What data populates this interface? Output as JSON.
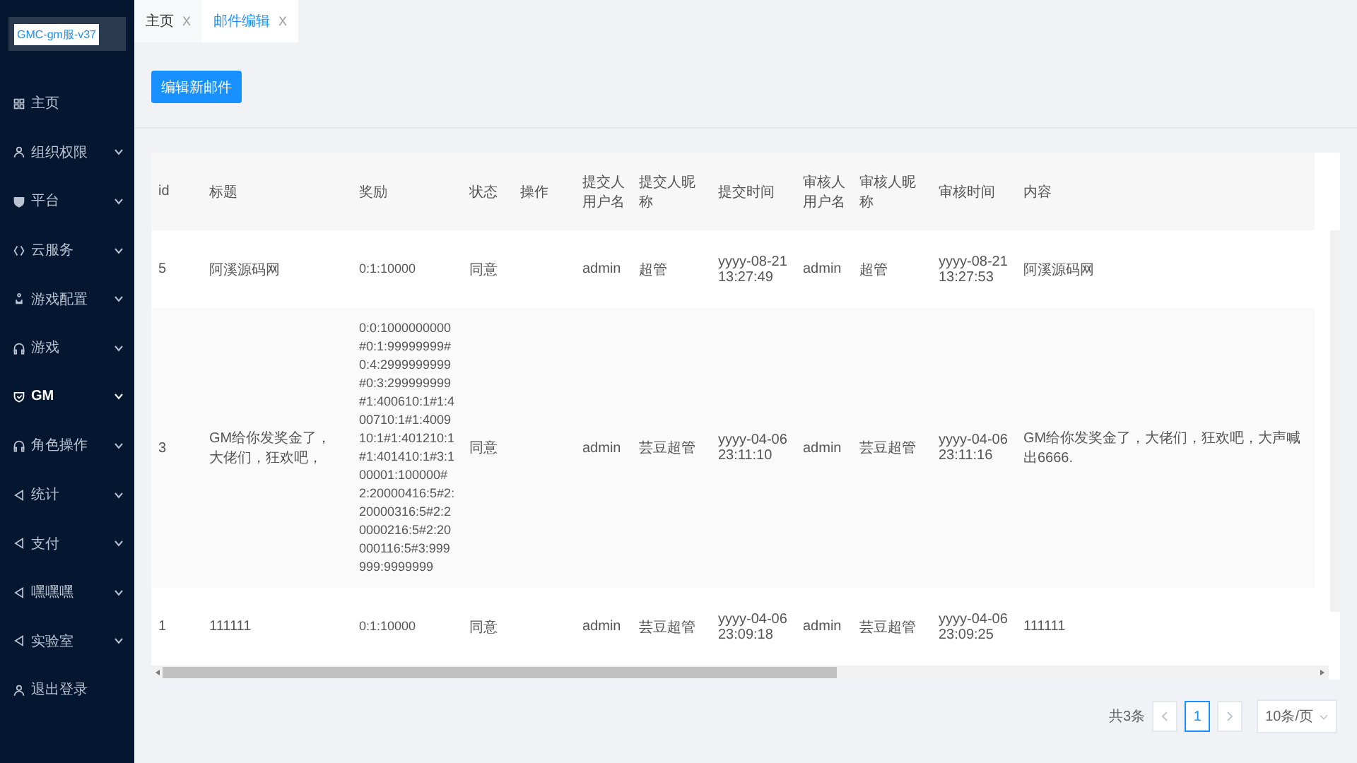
{
  "sidebar": {
    "logo": "GMC-gm服-v37",
    "items": [
      {
        "label": "主页",
        "expandable": false,
        "selected": false
      },
      {
        "label": "组织权限",
        "expandable": true,
        "selected": false
      },
      {
        "label": "平台",
        "expandable": true,
        "selected": false
      },
      {
        "label": "云服务",
        "expandable": true,
        "selected": false
      },
      {
        "label": "游戏配置",
        "expandable": true,
        "selected": false
      },
      {
        "label": "游戏",
        "expandable": true,
        "selected": false
      },
      {
        "label": "GM",
        "expandable": true,
        "selected": true
      },
      {
        "label": "角色操作",
        "expandable": true,
        "selected": false
      },
      {
        "label": "统计",
        "expandable": true,
        "selected": false
      },
      {
        "label": "支付",
        "expandable": true,
        "selected": false
      },
      {
        "label": "嘿嘿嘿",
        "expandable": true,
        "selected": false
      },
      {
        "label": "实验室",
        "expandable": true,
        "selected": false
      },
      {
        "label": "退出登录",
        "expandable": false,
        "selected": false
      }
    ]
  },
  "tabs": [
    {
      "label": "主页",
      "close": "X",
      "selected": false
    },
    {
      "label": "邮件编辑",
      "close": "X",
      "selected": true
    }
  ],
  "new_button": "编辑新邮件",
  "table": {
    "columns": [
      "id",
      "标题",
      "奖励",
      "状态",
      "操作",
      "提交人用户名",
      "提交人昵称",
      "提交时间",
      "审核人用户名",
      "审核人昵称",
      "审核时间",
      "内容"
    ],
    "rows": [
      [
        "5",
        "阿溪源码网",
        "0:1:10000",
        "同意",
        "",
        "admin",
        "超管",
        "yyyy-08-21 13:27:49",
        "admin",
        "超管",
        "yyyy-08-21 13:27:53",
        "阿溪源码网"
      ],
      [
        "3",
        "GM给你发奖金了，大佬们，狂欢吧，",
        "0:0:1000000000#0:1:99999999#0:4:2999999999#0:3:299999999#1:400610:1#1:400710:1#1:400910:1#1:401210:1#1:401410:1#3:100001:100000#2:20000416:5#2:20000316:5#2:20000216:5#2:20000116:5#3:999999:9999999",
        "同意",
        "",
        "admin",
        "芸豆超管",
        "yyyy-04-06 23:11:10",
        "admin",
        "芸豆超管",
        "yyyy-04-06 23:11:16",
        "GM给你发奖金了，大佬们，狂欢吧，大声喊出6666."
      ],
      [
        "1",
        "111111",
        "0:1:10000",
        "同意",
        "",
        "admin",
        "芸豆超管",
        "yyyy-04-06 23:09:18",
        "admin",
        "芸豆超管",
        "yyyy-04-06 23:09:25",
        "111111"
      ]
    ]
  },
  "pagination": {
    "total": "共3条",
    "pages": [
      {
        "label": "1",
        "selected": true
      }
    ],
    "page_size": "10条/页"
  }
}
